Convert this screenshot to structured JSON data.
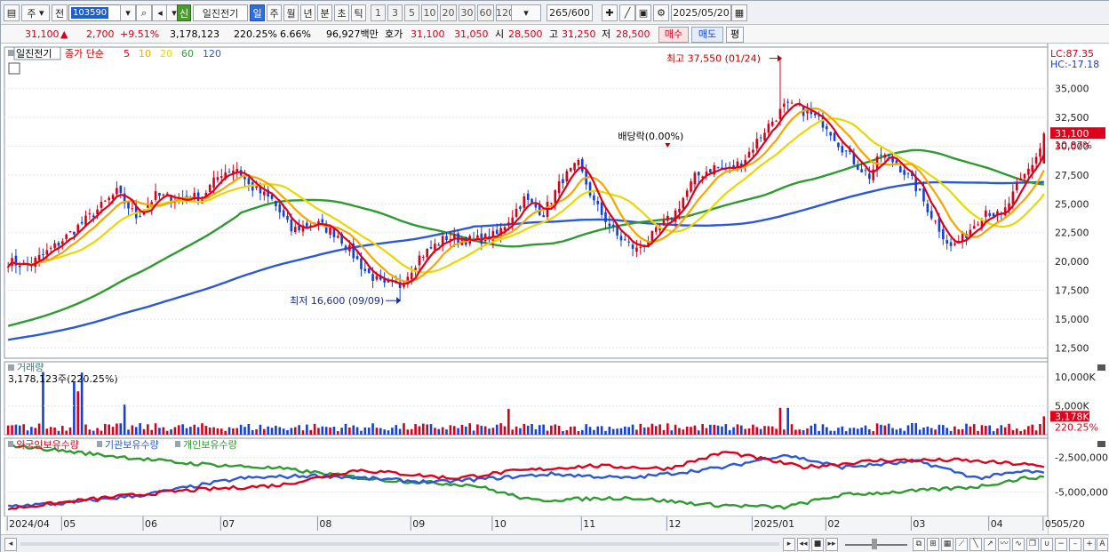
{
  "toolbar": {
    "cycle_label": "주",
    "prev_label": "전",
    "stock_code": "103590",
    "shin_label": "신",
    "stock_name": "일진전기",
    "periods": [
      "일",
      "주",
      "월",
      "년",
      "분",
      "초",
      "틱"
    ],
    "active_period": "일",
    "counts": [
      "1",
      "3",
      "5",
      "10",
      "20",
      "30",
      "60",
      "120"
    ],
    "view_count": "265",
    "view_total": "/600",
    "date": "2025/05/20"
  },
  "quote": {
    "price": "31,100",
    "change": "2,700",
    "change_pct": "+9.51%",
    "volume": "3,178,123",
    "volume_ratio": "220.25%",
    "turnover_pct": "6.66%",
    "trade_value": "96,927백만",
    "hoga_label": "호가",
    "hoga_ask": "31,100",
    "hoga_bid": "31,050",
    "open_label": "시",
    "open": "28,500",
    "high_label": "고",
    "high": "31,250",
    "low_label": "저",
    "low": "28,500",
    "buy_label": "매수",
    "sell_label": "매도",
    "eval_label": "평"
  },
  "chart_data": {
    "type": "candlestick",
    "price_legend": {
      "name": "일진전기",
      "ma_label": "종가 단순",
      "periods": [
        "5",
        "10",
        "20",
        "60",
        "120"
      ],
      "colors": [
        "#e0001b",
        "#f7a600",
        "#e8d800",
        "#2f9a2f",
        "#2c58d6"
      ]
    },
    "lc_label": "LC:87.35",
    "hc_label": "HC:-17.18",
    "y_ticks": [
      35000,
      32500,
      30000,
      27500,
      25000,
      22500,
      20000,
      17500,
      15000,
      12500
    ],
    "y_range": [
      11600,
      38600
    ],
    "current_price_tag": "31,100",
    "current_pct_tag": "10.87%",
    "annotations": {
      "high": "최고 37,550 (01/24)",
      "low": "최저 16,600 (09/09)",
      "dividend": "배당락(0.00%)"
    },
    "x_labels": [
      "2024/04",
      "05",
      "06",
      "07",
      "08",
      "09",
      "10",
      "11",
      "12",
      "2025/01",
      "02",
      "03",
      "04",
      "05",
      "05/20"
    ],
    "close_anchors": [
      [
        0,
        20000
      ],
      [
        5,
        19600
      ],
      [
        12,
        21300
      ],
      [
        20,
        23600
      ],
      [
        28,
        26000
      ],
      [
        33,
        23900
      ],
      [
        38,
        25700
      ],
      [
        44,
        25400
      ],
      [
        50,
        25700
      ],
      [
        55,
        27700
      ],
      [
        59,
        28100
      ],
      [
        62,
        26600
      ],
      [
        68,
        25300
      ],
      [
        73,
        22700
      ],
      [
        79,
        23400
      ],
      [
        85,
        22300
      ],
      [
        92,
        19200
      ],
      [
        97,
        17800
      ],
      [
        101,
        17900
      ],
      [
        106,
        20400
      ],
      [
        113,
        22100
      ],
      [
        120,
        21800
      ],
      [
        126,
        22300
      ],
      [
        133,
        25400
      ],
      [
        138,
        24200
      ],
      [
        143,
        27200
      ],
      [
        147,
        28400
      ],
      [
        151,
        25100
      ],
      [
        157,
        22200
      ],
      [
        162,
        21000
      ],
      [
        167,
        22500
      ],
      [
        172,
        24300
      ],
      [
        177,
        27300
      ],
      [
        182,
        28200
      ],
      [
        186,
        27900
      ],
      [
        190,
        29000
      ],
      [
        195,
        31400
      ],
      [
        200,
        33400
      ],
      [
        203,
        33400
      ],
      [
        207,
        32700
      ],
      [
        211,
        31800
      ],
      [
        214,
        30300
      ],
      [
        219,
        28300
      ],
      [
        222,
        27400
      ],
      [
        225,
        29300
      ],
      [
        229,
        28500
      ],
      [
        233,
        27000
      ],
      [
        238,
        24000
      ],
      [
        243,
        21200
      ],
      [
        247,
        22400
      ],
      [
        252,
        24500
      ],
      [
        256,
        23800
      ],
      [
        260,
        26400
      ],
      [
        264,
        28500
      ],
      [
        266,
        29800
      ],
      [
        267,
        31100
      ]
    ],
    "volume_legend": "거래량",
    "volume_value": "3,178,123주(220.25%)",
    "volume_ticks": [
      "10,000K",
      "5,000K"
    ],
    "volume_tag": "3,178K",
    "volume_ratio_tag": "220.25%",
    "holdings_legend": [
      "외국인보유수량",
      "기관보유수량",
      "개인보유수량"
    ],
    "holdings_colors": [
      "#e0001b",
      "#2c58d6",
      "#2f9a2f"
    ],
    "holdings_ticks": [
      "-2,500,000",
      "-5,000,000"
    ]
  }
}
